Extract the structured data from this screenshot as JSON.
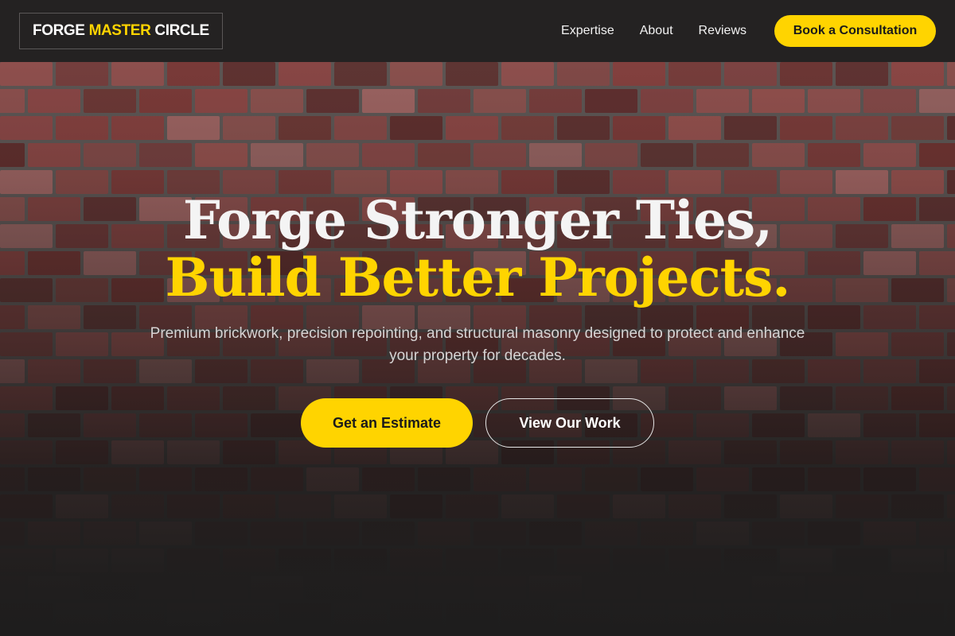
{
  "brand": {
    "word1": "FORGE",
    "word2": "MASTER",
    "word3": "CIRCLE"
  },
  "nav": {
    "items": [
      {
        "label": "Expertise"
      },
      {
        "label": "About"
      },
      {
        "label": "Reviews"
      }
    ],
    "cta_label": "Book a Consultation"
  },
  "hero": {
    "headline_line1": "Forge Stronger Ties,",
    "headline_line2": "Build Better Projects.",
    "subtitle": "Premium brickwork, precision repointing, and structural masonry designed to protect and enhance your property for decades.",
    "primary_button": "Get an Estimate",
    "secondary_button": "View Our Work"
  },
  "colors": {
    "accent": "#ffd400",
    "header_bg": "#242222",
    "page_bg": "#1e1d1d",
    "brick_palette": [
      "#7a3a38",
      "#8a4644",
      "#6e3331",
      "#934f4c",
      "#5f2d2c",
      "#a06462",
      "#84403e"
    ]
  }
}
